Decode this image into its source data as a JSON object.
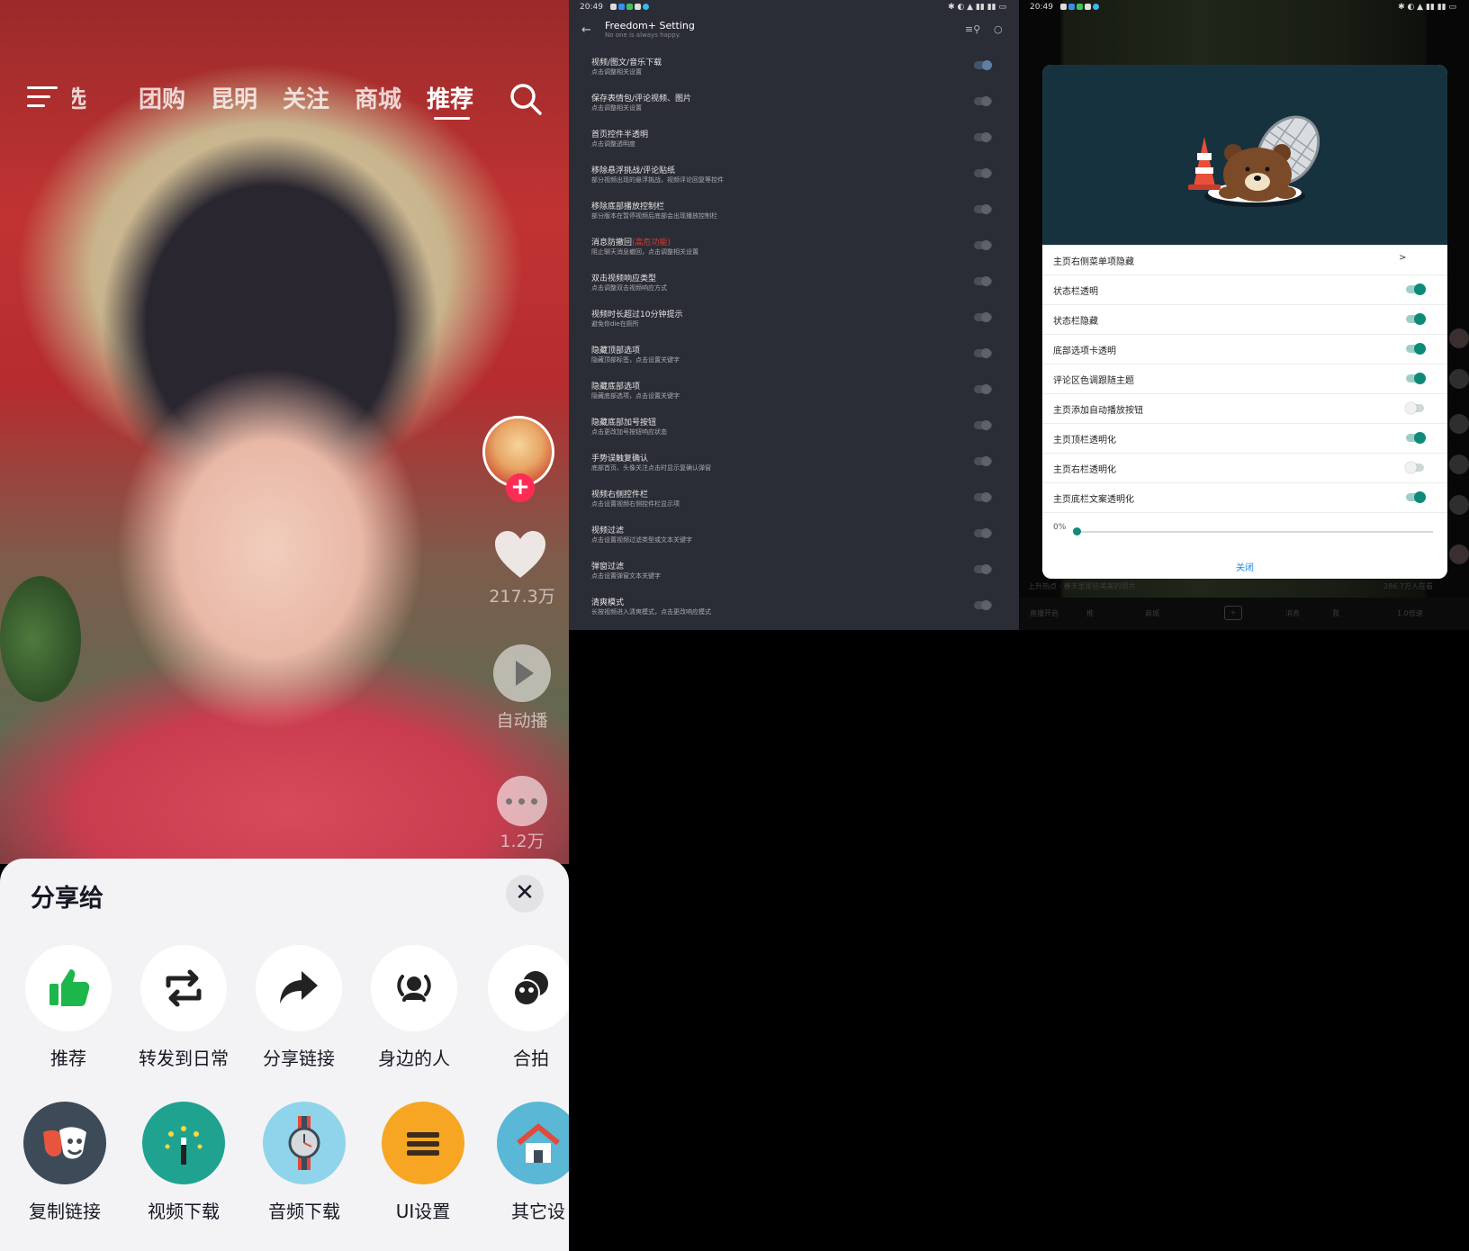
{
  "panel1": {
    "nav_tabs": [
      "精选",
      "团购",
      "昆明",
      "关注",
      "商城",
      "推荐"
    ],
    "active_tab": "推荐",
    "like_count": "217.3万",
    "auto_play_label": "自动播",
    "comment_count": "1.2万",
    "share_title": "分享给",
    "share_row1": [
      {
        "label": "推荐",
        "icon": "thumbs-up-icon",
        "color": "#1db64b"
      },
      {
        "label": "转发到日常",
        "icon": "repost-icon",
        "color": "#222222"
      },
      {
        "label": "分享链接",
        "icon": "share-arrow-icon",
        "color": "#222222"
      },
      {
        "label": "身边的人",
        "icon": "nearby-people-icon",
        "color": "#222222"
      },
      {
        "label": "合拍",
        "icon": "duet-icon",
        "color": "#222222"
      }
    ],
    "share_row2": [
      {
        "label": "复制链接",
        "icon": "mask-icon",
        "color": "#3d4a57"
      },
      {
        "label": "视频下载",
        "icon": "magic-wand-icon",
        "color": "#1fa390"
      },
      {
        "label": "音频下载",
        "icon": "watch-icon",
        "color": "#8fd4ea"
      },
      {
        "label": "UI设置",
        "icon": "list-icon",
        "color": "#f6a623"
      },
      {
        "label": "其它设",
        "icon": "house-icon",
        "color": "#5ab7d6"
      }
    ]
  },
  "panel2": {
    "status_time": "20:49",
    "title": "Freedom+ Setting",
    "subtitle": "No one is always happy.",
    "settings": [
      {
        "title": "视频/图文/音乐下载",
        "sub": "点击调整相关设置",
        "on": true
      },
      {
        "title": "保存表情包/评论视频、图片",
        "sub": "点击调整相关设置",
        "on": false
      },
      {
        "title": "首页控件半透明",
        "sub": "点击调整透明度",
        "on": false
      },
      {
        "title": "移除悬浮挑战/评论贴纸",
        "sub": "部分视频出现的悬浮挑战，视频评论回复等控件",
        "on": false
      },
      {
        "title": "移除底部播放控制栏",
        "sub": "部分版本在暂停视频后底部会出现播放控制栏",
        "on": false
      },
      {
        "title": "消息防撤回",
        "warn": "(高危功能)",
        "sub": "阻止聊天消息撤回，点击调整相关设置",
        "on": false
      },
      {
        "title": "双击视频响应类型",
        "sub": "点击调整双击视频响应方式",
        "on": false
      },
      {
        "title": "视频时长超过10分钟提示",
        "sub": "避免你die在厕所",
        "on": false
      },
      {
        "title": "隐藏顶部选项",
        "sub": "隐藏顶部标签，点击设置关键字",
        "on": false
      },
      {
        "title": "隐藏底部选项",
        "sub": "隐藏底部选项，点击设置关键字",
        "on": false
      },
      {
        "title": "隐藏底部加号按钮",
        "sub": "点击更改加号按钮响应状态",
        "on": false
      },
      {
        "title": "手势误触复确认",
        "sub": "底部首页、头像关注点击时显示复确认弹窗",
        "on": false
      },
      {
        "title": "视频右侧控件栏",
        "sub": "点击设置视频右侧控件栏显示项",
        "on": false
      },
      {
        "title": "视频过滤",
        "sub": "点击设置视频过滤类型或文本关键字",
        "on": false
      },
      {
        "title": "弹窗过滤",
        "sub": "点击设置弹窗文本关键字",
        "on": false
      },
      {
        "title": "清爽模式",
        "sub": "长按视频进入清爽模式，点击更改响应模式",
        "on": false
      }
    ]
  },
  "panel3": {
    "status_time": "20:49",
    "dialog_rows": [
      {
        "title": "主页右侧菜单项隐藏",
        "type": "arrow",
        "arrow": ">"
      },
      {
        "title": "状态栏透明",
        "type": "switch",
        "on": true
      },
      {
        "title": "状态栏隐藏",
        "type": "switch",
        "on": true
      },
      {
        "title": "底部选项卡透明",
        "type": "switch",
        "on": true
      },
      {
        "title": "评论区色调跟随主题",
        "type": "switch",
        "on": true
      },
      {
        "title": "主页添加自动播放按钮",
        "type": "switch",
        "on": false
      },
      {
        "title": "主页顶栏透明化",
        "type": "switch",
        "on": true
      },
      {
        "title": "主页右栏透明化",
        "type": "switch",
        "on": false
      },
      {
        "title": "主页底栏文案透明化",
        "type": "switch",
        "on": true
      }
    ],
    "slider_label": "0%",
    "slider_value": 0,
    "close_label": "关闭",
    "ticker_left": "上升热点 · 春天里那些美美的照片",
    "ticker_right": "286.7万人在看",
    "bottom_items": [
      "直播开启",
      "推",
      "商城",
      "消息",
      "我",
      "1.0倍速"
    ]
  },
  "colors": {
    "accent_red": "#fe2c55",
    "toggle_teal": "#0e8a78",
    "dialog_link": "#1e88e5"
  }
}
